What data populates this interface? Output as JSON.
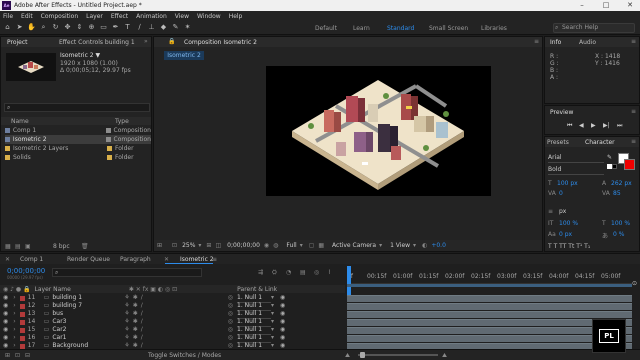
{
  "window": {
    "title": "Adobe After Effects - Untitled Project.aep *"
  },
  "menu": [
    "File",
    "Edit",
    "Composition",
    "Layer",
    "Effect",
    "Animation",
    "View",
    "Window",
    "Help"
  ],
  "workspaces": [
    "Default",
    "Learn",
    "Standard",
    "Small Screen",
    "Libraries"
  ],
  "search": {
    "placeholder": "Search Help"
  },
  "project": {
    "tab": "Project",
    "effect_tab": "Effect Controls building 1",
    "thumb_name": "Isometric 2 ▼",
    "thumb_size": "1920 x 1080 (1.00)",
    "thumb_dur": "Δ 0;00;05;12, 29.97 fps",
    "search_placeholder": "",
    "col_name": "Name",
    "col_type": "Type",
    "items": [
      {
        "name": "Comp 1",
        "type": "Composition",
        "color": "#8c8c8c"
      },
      {
        "name": "Isometric 2",
        "type": "Composition",
        "color": "#8c8c8c"
      },
      {
        "name": "Isometric 2 Layers",
        "type": "Folder",
        "color": "#d9b04a"
      },
      {
        "name": "Solids",
        "type": "Folder",
        "color": "#d9b04a"
      }
    ],
    "bpc": "8 bpc"
  },
  "composition": {
    "tab": "Composition Isometric 2",
    "subtab": "Isometric 2",
    "zoom": "25%",
    "timecode": "0;00;00;00",
    "resolution": "Full",
    "camera": "Active Camera",
    "views": "1 View",
    "offset": "+0.0"
  },
  "info": {
    "tab": "Info",
    "audio_tab": "Audio",
    "r": "R :",
    "g": "G :",
    "b": "B :",
    "a": "A :",
    "x": "X : 1418",
    "y": "Y : 1416"
  },
  "preview": {
    "tab": "Preview"
  },
  "character": {
    "tab": "Character",
    "presets_tab": "Presets",
    "font": "Arial",
    "style": "Bold",
    "size": "100 px",
    "leading": "262 px",
    "kerning": "0",
    "tracking": "85",
    "unit": "px",
    "vscale": "100 %",
    "hscale": "100 %",
    "baseline": "0 px",
    "tsume": "0 %"
  },
  "timeline": {
    "tabs": [
      "Comp 1",
      "Render Queue",
      "Paragraph",
      "Isometric 2"
    ],
    "timecode": "0;00;00;00",
    "timecode_sub": "00000 (29.97 fps)",
    "col_layer": "Layer Name",
    "col_parent": "Parent & Link",
    "ruler": [
      "0f",
      "00:15f",
      "01:00f",
      "01:15f",
      "02:00f",
      "02:15f",
      "03:00f",
      "03:15f",
      "04:00f",
      "04:15f",
      "05:00f"
    ],
    "layers": [
      {
        "num": "11",
        "name": "building 1",
        "parent": "1. Null 1"
      },
      {
        "num": "12",
        "name": "building 7",
        "parent": "1. Null 1"
      },
      {
        "num": "13",
        "name": "bus",
        "parent": "1. Null 1"
      },
      {
        "num": "14",
        "name": "Car3",
        "parent": "1. Null 1"
      },
      {
        "num": "15",
        "name": "Car2",
        "parent": "1. Null 1"
      },
      {
        "num": "16",
        "name": "Car1",
        "parent": "1. Null 1"
      },
      {
        "num": "17",
        "name": "Background",
        "parent": "1. Null 1"
      }
    ],
    "toggle": "Toggle Switches / Modes"
  },
  "watermark": "PL",
  "colors": {
    "accent": "#2d8ceb",
    "label_red": "#b23a3a",
    "track": "#606a72"
  }
}
